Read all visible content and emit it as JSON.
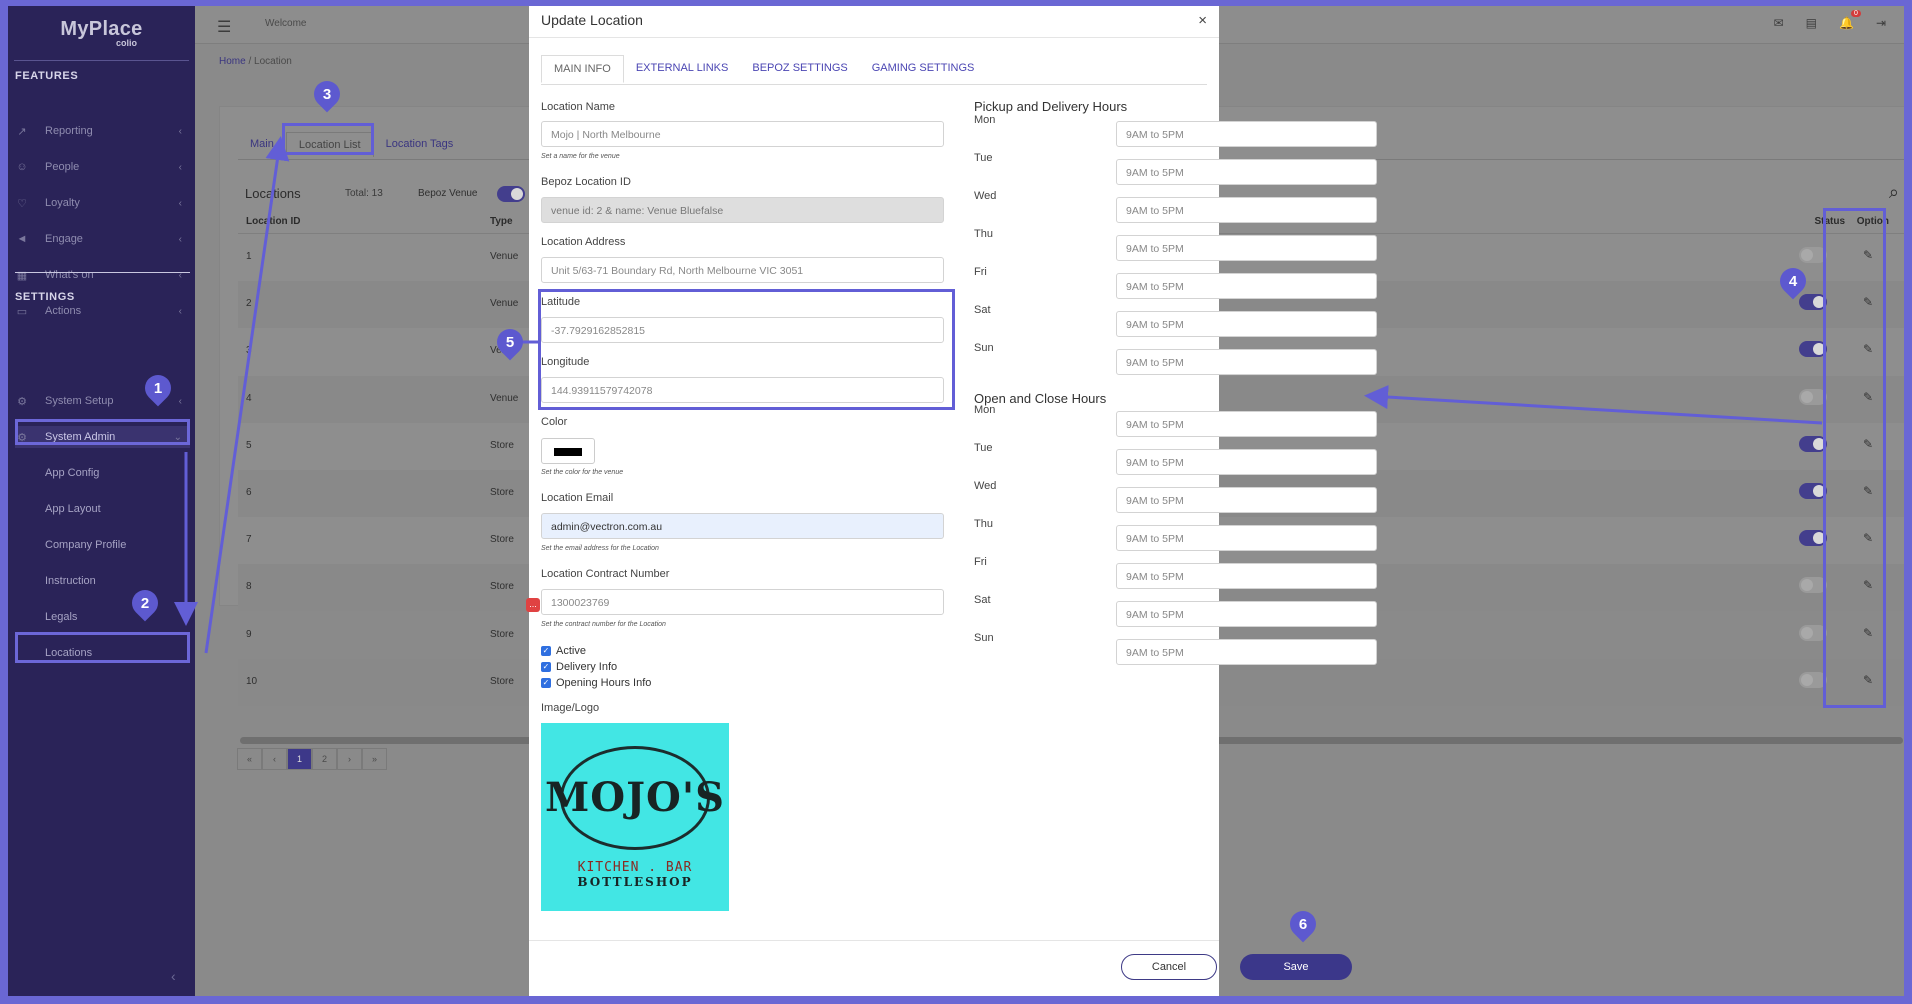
{
  "sidebar": {
    "brand": "MyPlace",
    "brand_sub": "colio",
    "features_title": "FEATURES",
    "features": [
      {
        "label": "Reporting",
        "icon": "chart-icon"
      },
      {
        "label": "People",
        "icon": "people-icon"
      },
      {
        "label": "Loyalty",
        "icon": "heart-icon"
      },
      {
        "label": "Engage",
        "icon": "megaphone-icon"
      },
      {
        "label": "What's on",
        "icon": "calendar-icon"
      },
      {
        "label": "Actions",
        "icon": "monitor-icon"
      }
    ],
    "settings_title": "SETTINGS",
    "settings": [
      {
        "label": "System Setup",
        "icon": "gear-icon"
      },
      {
        "label": "System Admin",
        "icon": "gear-icon"
      }
    ],
    "submenu": [
      "App Config",
      "App Layout",
      "Company Profile",
      "Instruction",
      "Legals",
      "Locations"
    ]
  },
  "topbar": {
    "welcome": "Welcome",
    "notification_count": "0"
  },
  "breadcrumb": {
    "home": "Home",
    "sep": "/",
    "current": "Location"
  },
  "page": {
    "tabs": [
      "Main",
      "Location List",
      "Location Tags"
    ],
    "heading": "Locations",
    "total": "Total: 13",
    "bepoz_label": "Bepoz Venue",
    "columns": {
      "id": "Location ID",
      "type": "Type",
      "status": "Status",
      "option": "Option"
    },
    "rows": [
      {
        "id": "1",
        "type": "Venue",
        "on": false
      },
      {
        "id": "2",
        "type": "Venue",
        "on": true
      },
      {
        "id": "3",
        "type": "Venue",
        "on": true
      },
      {
        "id": "4",
        "type": "Venue",
        "on": false
      },
      {
        "id": "5",
        "type": "Store",
        "on": true
      },
      {
        "id": "6",
        "type": "Store",
        "on": true
      },
      {
        "id": "7",
        "type": "Store",
        "on": true
      },
      {
        "id": "8",
        "type": "Store",
        "on": false
      },
      {
        "id": "9",
        "type": "Store",
        "on": false
      },
      {
        "id": "10",
        "type": "Store",
        "on": false
      }
    ],
    "pager": [
      "«",
      "‹",
      "1",
      "2",
      "›",
      "»"
    ]
  },
  "modal": {
    "title": "Update Location",
    "close": "×",
    "tabs": [
      "MAIN INFO",
      "EXTERNAL LINKS",
      "BEPOZ SETTINGS",
      "GAMING SETTINGS"
    ],
    "location_name": {
      "label": "Location Name",
      "value": "Mojo | North Melbourne",
      "help": "Set a name for the venue"
    },
    "bepoz_id": {
      "label": "Bepoz Location ID",
      "value": "venue id: 2 & name: Venue Bluefalse"
    },
    "address": {
      "label": "Location Address",
      "value": "Unit 5/63-71 Boundary Rd, North Melbourne VIC 3051"
    },
    "latitude": {
      "label": "Latitude",
      "value": "-37.7929162852815"
    },
    "longitude": {
      "label": "Longitude",
      "value": "144.93911579742078"
    },
    "color": {
      "label": "Color",
      "value": "#000000",
      "help": "Set the color for the venue"
    },
    "email": {
      "label": "Location Email",
      "value": "admin@vectron.com.au",
      "help": "Set the email address for the Location"
    },
    "contract": {
      "label": "Location Contract Number",
      "value": "1300023769",
      "help": "Set the contract number for the Location",
      "badge": "..."
    },
    "checks": [
      "Active",
      "Delivery Info",
      "Opening Hours Info"
    ],
    "image_label": "Image/Logo",
    "logo": {
      "word": "MOJO'S",
      "line2": "KITCHEN . BAR",
      "line3": "BOTTLESHOP"
    },
    "pickup_title": "Pickup and Delivery Hours",
    "open_title": "Open and Close Hours",
    "days": [
      "Mon",
      "Tue",
      "Wed",
      "Thu",
      "Fri",
      "Sat",
      "Sun"
    ],
    "hours_value": "9AM to 5PM",
    "cancel": "Cancel",
    "save": "Save"
  },
  "annotations": [
    "1",
    "2",
    "3",
    "4",
    "5",
    "6"
  ]
}
